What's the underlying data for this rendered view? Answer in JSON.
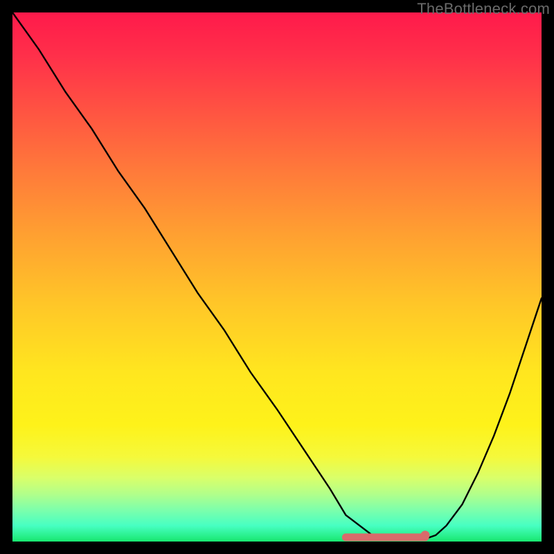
{
  "watermark": "TheBottleneck.com",
  "colors": {
    "frame": "#000000",
    "gradient_top": "#ff1a4b",
    "gradient_bottom": "#18e86f",
    "curve": "#000000",
    "marker": "#d96b6b"
  },
  "chart_data": {
    "type": "line",
    "title": "",
    "xlabel": "",
    "ylabel": "",
    "xlim": [
      0,
      100
    ],
    "ylim": [
      0,
      100
    ],
    "grid": false,
    "legend": false,
    "series": [
      {
        "name": "bottleneck-curve",
        "x": [
          0,
          5,
          10,
          15,
          20,
          25,
          30,
          35,
          40,
          45,
          50,
          55,
          60,
          63,
          68,
          72,
          75,
          78,
          80,
          82,
          85,
          88,
          91,
          94,
          97,
          100
        ],
        "values": [
          100,
          93,
          85,
          78,
          70,
          63,
          55,
          47,
          40,
          32,
          25,
          17.5,
          10,
          5,
          1.2,
          0.5,
          0.4,
          0.5,
          1.2,
          3,
          7,
          13,
          20,
          28,
          37,
          46
        ]
      }
    ],
    "markers": [
      {
        "name": "flat-region-dash",
        "x_start": 63,
        "x_end": 78,
        "y": 0.8
      },
      {
        "name": "end-dot",
        "x": 78,
        "y": 1.2
      }
    ]
  }
}
